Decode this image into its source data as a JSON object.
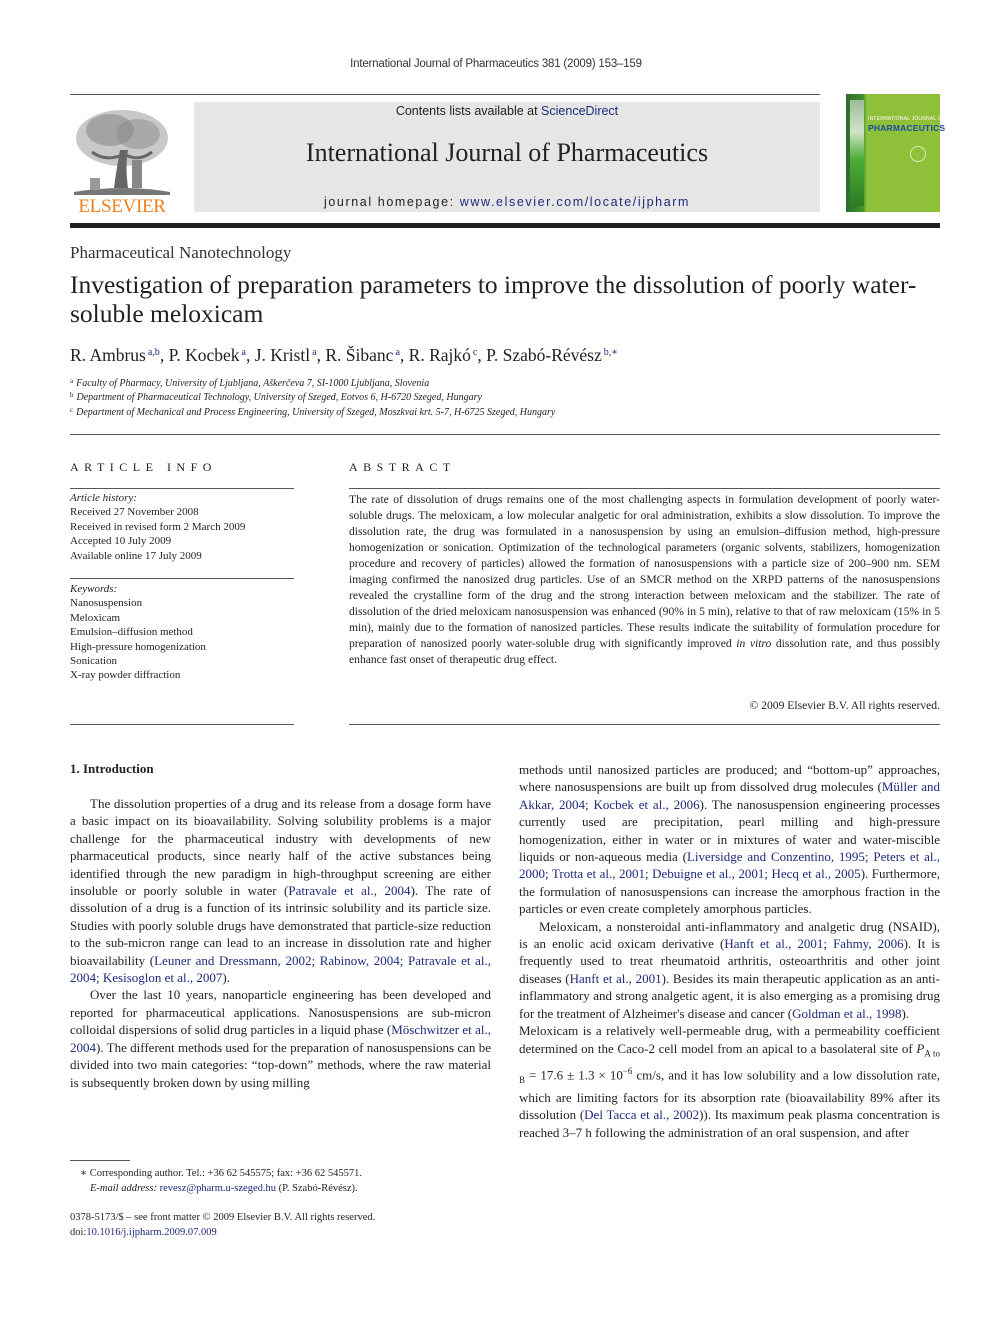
{
  "running_head": "International Journal of Pharmaceutics 381 (2009) 153–159",
  "header": {
    "publisher_logo_text": "ELSEVIER",
    "contents_prefix": "Contents lists available at ",
    "contents_link": "ScienceDirect",
    "journal_title": "International Journal of Pharmaceutics",
    "homepage_prefix": "journal homepage: ",
    "homepage_link": "www.elsevier.com/locate/ijpharm",
    "cover_line1": "INTERNATIONAL JOURNAL OF",
    "cover_line2": "PHARMACEUTICS",
    "colors": {
      "banner_bg": "#e6e6e6",
      "elsevier_orange": "#f07f1c",
      "link_blue": "#1f2a7a",
      "cover_green": "#8fc03a"
    }
  },
  "article": {
    "section": "Pharmaceutical Nanotechnology",
    "title": "Investigation of preparation parameters to improve the dissolution of poorly water-soluble meloxicam",
    "authors": [
      {
        "name": "R. Ambrus",
        "sup": "a,b",
        "sep": ", "
      },
      {
        "name": "P. Kocbek",
        "sup": "a",
        "sep": ", "
      },
      {
        "name": "J. Kristl",
        "sup": "a",
        "sep": ", "
      },
      {
        "name": "R. Šibanc",
        "sup": "a",
        "sep": ", "
      },
      {
        "name": "R. Rajkó",
        "sup": "c",
        "sep": ", "
      },
      {
        "name": "P. Szabó-Révész",
        "sup": "b,∗",
        "sep": ""
      }
    ],
    "affiliations": [
      {
        "key": "a",
        "text": "Faculty of Pharmacy, University of Ljubljana, Aškerčeva 7, SI-1000 Ljubljana, Slovenia"
      },
      {
        "key": "b",
        "text": "Department of Pharmaceutical Technology, University of Szeged, Eotvos 6, H-6720 Szeged, Hungary"
      },
      {
        "key": "c",
        "text": "Department of Mechanical and Process Engineering, University of Szeged, Moszkvai krt. 5-7, H-6725 Szeged, Hungary"
      }
    ]
  },
  "article_info": {
    "heading": "ARTICLE INFO",
    "history_label": "Article history:",
    "history": [
      "Received 27 November 2008",
      "Received in revised form 2 March 2009",
      "Accepted 10 July 2009",
      "Available online 17 July 2009"
    ],
    "keywords_label": "Keywords:",
    "keywords": [
      "Nanosuspension",
      "Meloxicam",
      "Emulsion–diffusion method",
      "High-pressure homogenization",
      "Sonication",
      "X-ray powder diffraction"
    ]
  },
  "abstract": {
    "heading": "ABSTRACT",
    "text_before_italic": "The rate of dissolution of drugs remains one of the most challenging aspects in formulation development of poorly water-soluble drugs. The meloxicam, a low molecular analgetic for oral administration, exhibits a slow dissolution. To improve the dissolution rate, the drug was formulated in a nanosuspension by using an emulsion–diffusion method, high-pressure homogenization or sonication. Optimization of the technological parameters (organic solvents, stabilizers, homogenization procedure and recovery of particles) allowed the formation of nanosuspensions with a particle size of 200–900 nm. SEM imaging confirmed the nanosized drug particles. Use of an SMCR method on the XRPD patterns of the nanosuspensions revealed the crystalline form of the drug and the strong interaction between meloxicam and the stabilizer. The rate of dissolution of the dried meloxicam nanosuspension was enhanced (90% in 5 min), relative to that of raw meloxicam (15% in 5 min), mainly due to the formation of nanosized particles. These results indicate the suitability of formulation procedure for preparation of nanosized poorly water-soluble drug with significantly improved ",
    "italic": "in vitro",
    "text_after_italic": " dissolution rate, and thus possibly enhance fast onset of therapeutic drug effect.",
    "copyright": "© 2009 Elsevier B.V. All rights reserved."
  },
  "introduction": {
    "heading": "1.  Introduction",
    "p1": [
      {
        "t": "The dissolution properties of a drug and its release from a dosage form have a basic impact on its bioavailability. Solving solubility problems is a major challenge for the pharmaceutical industry with developments of new pharmaceutical products, since nearly half of the active substances being identified through the new paradigm in high-throughput screening are either insoluble or poorly soluble in water ("
      },
      {
        "t": "Patravale et al., 2004",
        "link": true
      },
      {
        "t": "). The rate of dissolution of a drug is a function of its intrinsic solubility and its particle size. Studies with poorly soluble drugs have demonstrated that particle-size reduction to the sub-micron range can lead to an increase in dissolution rate and higher bioavailability ("
      },
      {
        "t": "Leuner and Dressmann, 2002; Rabinow, 2004; Patravale et al., 2004; Kesisoglon et al., 2007",
        "link": true
      },
      {
        "t": ")."
      }
    ],
    "p2": [
      {
        "t": "Over the last 10 years, nanoparticle engineering has been developed and reported for pharmaceutical applications. Nanosuspensions are sub-micron colloidal dispersions of solid drug particles in a liquid phase ("
      },
      {
        "t": "Möschwitzer et al., 2004",
        "link": true
      },
      {
        "t": "). The different methods used for the preparation of nanosuspensions can be divided into two main categories: “top-down” methods, where the raw material is subsequently broken down by using milling methods until nanosized particles are produced; and “bottom-up” approaches, where nanosuspensions are built up from dissolved drug molecules ("
      },
      {
        "t": "Müller and Akkar, 2004; Kocbek et al., 2006",
        "link": true
      },
      {
        "t": "). The nanosuspension engineering processes currently used are precipitation, pearl milling and high-pressure homogenization, either in water or in mixtures of water and water-miscible liquids or non-aqueous media ("
      },
      {
        "t": "Liversidge and Conzentino, 1995; Peters et al., 2000; Trotta et al., 2001; Debuigne et al., 2001; Hecq et al., 2005",
        "link": true
      },
      {
        "t": "). Furthermore, the formulation of nanosuspensions can increase the amorphous fraction in the particles or even create completely amorphous particles."
      }
    ],
    "p3": [
      {
        "t": "Meloxicam, a nonsteroidal anti-inflammatory and analgetic drug (NSAID), is an enolic acid oxicam derivative ("
      },
      {
        "t": "Hanft et al., 2001; Fahmy, 2006",
        "link": true
      },
      {
        "t": "). It is frequently used to treat rheumatoid arthritis, osteoarthritis and other joint diseases ("
      },
      {
        "t": "Hanft et al., 2001",
        "link": true
      },
      {
        "t": "). Besides its main therapeutic application as an anti-inflammatory and strong analgetic agent, it is also emerging as a promising drug for the treatment of Alzheimer's disease and cancer ("
      },
      {
        "t": "Goldman et al., 1998",
        "link": true
      },
      {
        "t": ")."
      }
    ],
    "p4": [
      {
        "t": "Meloxicam is a relatively well-permeable drug, with a permeability coefficient determined on the Caco-2 cell model from an apical to a basolateral site of "
      },
      {
        "t": "P",
        "italic": true
      },
      {
        "t": "A to B",
        "sub": true
      },
      {
        "t": " = 17.6 ± 1.3 × 10"
      },
      {
        "t": "−6",
        "sup": true
      },
      {
        "t": " cm/s, and it has low solubility and a low dissolution rate, which are limiting factors for its absorption rate (bioavailability 89% after its dissolution ("
      },
      {
        "t": "Del Tacca et al., 2002",
        "link": true
      },
      {
        "t": ")). Its maximum peak plasma concentration is reached 3–7 h following the administration of an oral suspension, and after"
      }
    ]
  },
  "footnotes": {
    "corresponding": "∗  Corresponding author. Tel.: +36 62 545575; fax: +36 62 545571.",
    "email_label": "E-mail address: ",
    "email": "revesz@pharm.u-szeged.hu",
    "email_suffix": " (P. Szabó-Révész).",
    "front_matter": "0378-5173/$ – see front matter © 2009 Elsevier B.V. All rights reserved.",
    "doi_label": "doi:",
    "doi": "10.1016/j.ijpharm.2009.07.009"
  }
}
